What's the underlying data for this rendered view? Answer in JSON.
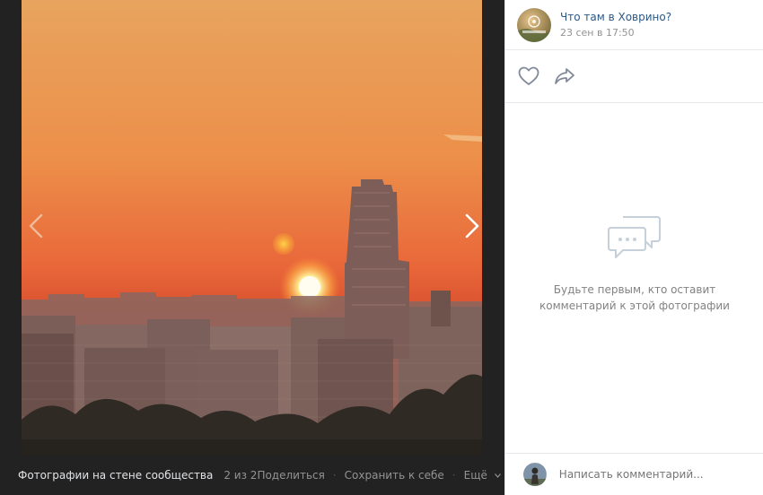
{
  "viewer": {
    "album_title": "Фотографии на стене сообщества",
    "counter": "2 из 2",
    "actions": {
      "share": "Поделиться",
      "save": "Сохранить к себе",
      "more": "Ещё"
    }
  },
  "post": {
    "group_name": "Что там в Ховрино?",
    "date": "23 сен в 17:50"
  },
  "comments": {
    "empty_line1": "Будьте первым, кто оставит",
    "empty_line2": "комментарий к этой фотографии",
    "placeholder": "Написать комментарий..."
  },
  "icons": {
    "prev": "chevron-left-icon",
    "next": "chevron-right-icon",
    "like": "heart-icon",
    "share": "share-arrow-icon",
    "empty": "chat-bubbles-icon",
    "more": "chevron-down-icon"
  },
  "colors": {
    "viewer_bg": "#222222",
    "link": "#2a5885",
    "muted": "#939393",
    "divider": "#e7e8ec"
  }
}
